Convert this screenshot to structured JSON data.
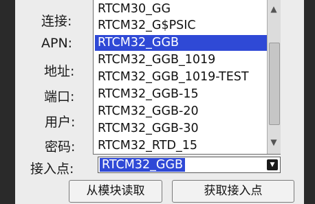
{
  "form": {
    "labels": {
      "connect": "连接:",
      "apn": "APN:",
      "address": "地址:",
      "port": "端口:",
      "user": "用户:",
      "password": "密码:",
      "mountpoint": "接入点:"
    },
    "mountpoint_value": "RTCM32_GGB"
  },
  "dropdown": {
    "options": [
      "RTCM30_GG",
      "RTCM32_G$PSIC",
      "RTCM32_GGB",
      "RTCM32_GGB_1019",
      "RTCM32_GGB_1019-TEST",
      "RTCM32_GGB-15",
      "RTCM32_GGB-20",
      "RTCM32_GGB-30",
      "RTCM32_RTD_15"
    ],
    "selected_index": 2
  },
  "buttons": {
    "read_from_module": "从模块读取",
    "get_mountpoint": "获取接入点"
  }
}
